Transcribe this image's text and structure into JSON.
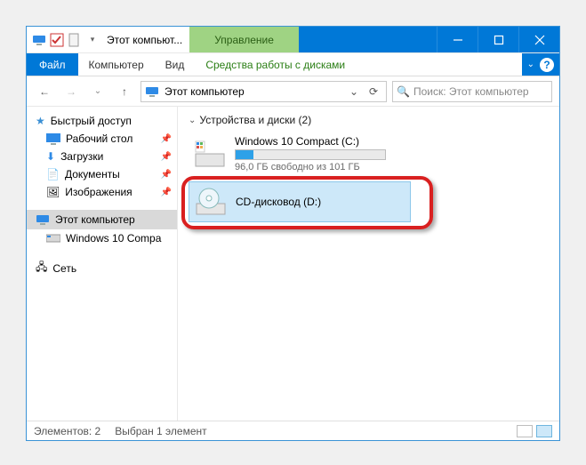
{
  "window": {
    "title": "Этот компьют...",
    "contextual_tab": "Управление"
  },
  "ribbon": {
    "file": "Файл",
    "tabs": [
      "Компьютер",
      "Вид"
    ],
    "context_tab": "Средства работы с дисками"
  },
  "address": {
    "location": "Этот компьютер",
    "search_placeholder": "Поиск: Этот компьютер"
  },
  "nav": {
    "quick_access": "Быстрый доступ",
    "items": [
      {
        "label": "Рабочий стол",
        "pinned": true
      },
      {
        "label": "Загрузки",
        "pinned": true
      },
      {
        "label": "Документы",
        "pinned": true
      },
      {
        "label": "Изображения",
        "pinned": true
      }
    ],
    "this_pc": "Этот компьютер",
    "this_pc_children": [
      {
        "label": "Windows 10 Compa"
      }
    ],
    "network": "Сеть"
  },
  "content": {
    "section": "Устройства и диски (2)",
    "drives": [
      {
        "name": "Windows 10 Compact (C:)",
        "sub": "96,0 ГБ свободно из 101 ГБ",
        "fill_pct": 12
      },
      {
        "name": "CD-дисковод (D:)",
        "sub": ""
      }
    ]
  },
  "status": {
    "count": "Элементов: 2",
    "selection": "Выбран 1 элемент"
  },
  "icons": {
    "star": "star-icon",
    "desktop": "desktop-icon",
    "downloads": "downloads-icon",
    "docs": "documents-icon",
    "pics": "pictures-icon",
    "pc": "pc-icon",
    "net": "network-icon",
    "hdd": "hdd-icon",
    "cd": "cd-icon"
  }
}
